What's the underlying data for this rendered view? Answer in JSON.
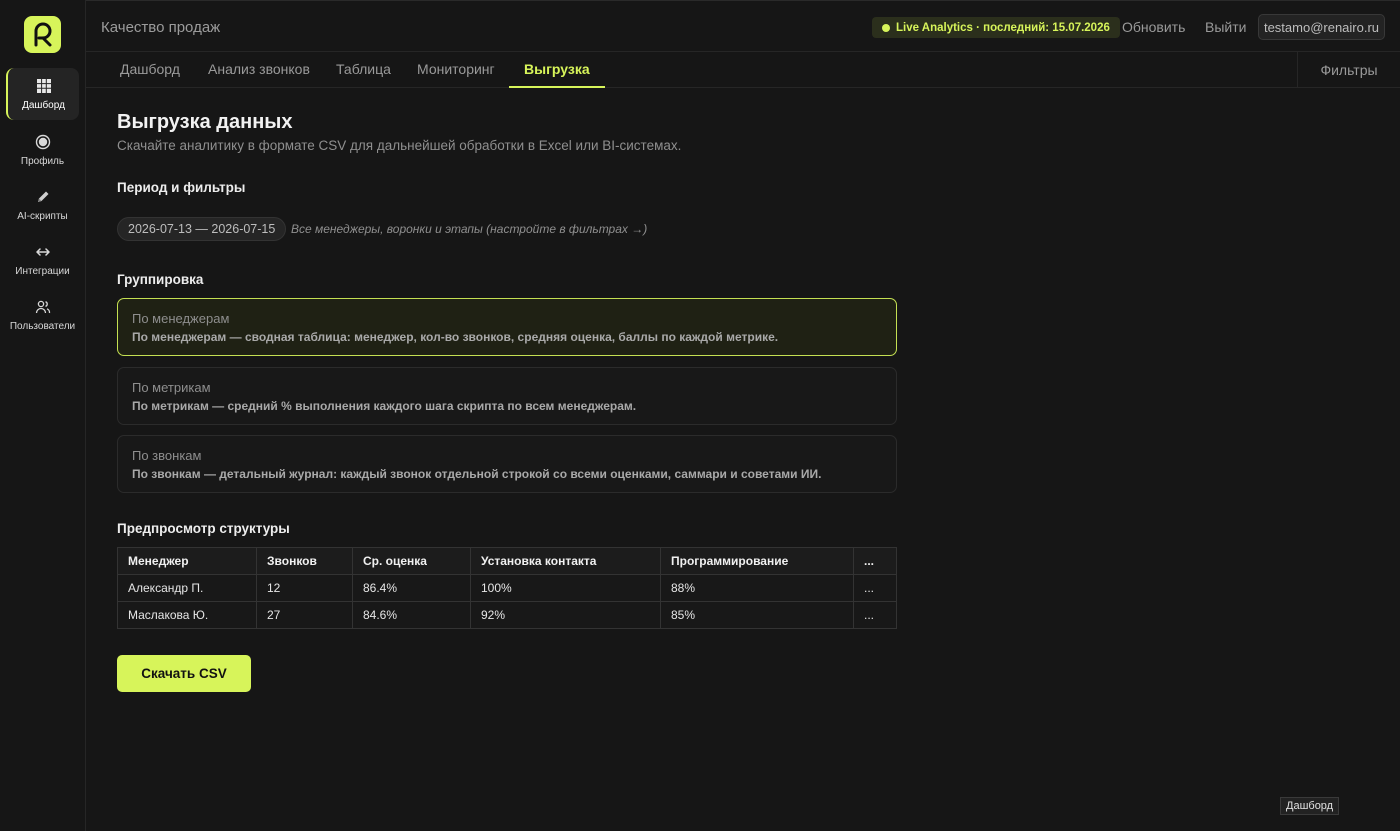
{
  "app": {
    "title": "Качество продаж"
  },
  "header": {
    "live_label": "Live Analytics · последний: 15.07.2026",
    "refresh_label": "Обновить",
    "logout_label": "Выйти",
    "user_email": "testamo@renairo.ru"
  },
  "sidebar": {
    "items": [
      {
        "label": "Дашборд",
        "icon": "grid-icon",
        "active": true
      },
      {
        "label": "Профиль",
        "icon": "profile-icon"
      },
      {
        "label": "AI-скрипты",
        "icon": "pen-icon"
      },
      {
        "label": "Интеграции",
        "icon": "arrows-icon"
      },
      {
        "label": "Пользователи",
        "icon": "users-icon"
      }
    ]
  },
  "tabs": [
    {
      "label": "Дашборд"
    },
    {
      "label": "Анализ звонков"
    },
    {
      "label": "Таблица"
    },
    {
      "label": "Мониторинг"
    },
    {
      "label": "Выгрузка",
      "active": true
    }
  ],
  "filters_label": "Фильтры",
  "page": {
    "title": "Выгрузка данных",
    "subtitle": "Скачайте аналитику в формате CSV для дальнейшей обработки в Excel или BI-системах."
  },
  "period": {
    "section_title": "Период и фильтры",
    "range": "2026-07-13 — 2026-07-15",
    "hint": "Все менеджеры, воронки и этапы (настройте в фильтрах →)"
  },
  "grouping": {
    "section_title": "Группировка",
    "options": [
      {
        "title": "По менеджерам",
        "desc": "По менеджерам — сводная таблица: менеджер, кол-во звонков, средняя оценка, баллы по каждой метрике.",
        "selected": true
      },
      {
        "title": "По метрикам",
        "desc": "По метрикам — средний % выполнения каждого шага скрипта по всем менеджерам."
      },
      {
        "title": "По звонкам",
        "desc": "По звонкам — детальный журнал: каждый звонок отдельной строкой со всеми оценками, саммари и советами ИИ."
      }
    ]
  },
  "preview": {
    "section_title": "Предпросмотр структуры",
    "columns": [
      "Менеджер",
      "Звонков",
      "Ср. оценка",
      "Установка контакта",
      "Программирование",
      "..."
    ],
    "rows": [
      [
        "Александр П.",
        "12",
        "86.4%",
        "100%",
        "88%",
        "..."
      ],
      [
        "Маслакова Ю.",
        "27",
        "84.6%",
        "92%",
        "85%",
        "..."
      ]
    ]
  },
  "download_label": "Скачать CSV",
  "tooltip": "Дашборд",
  "colors": {
    "accent": "#d7f45a",
    "background": "#161616"
  }
}
